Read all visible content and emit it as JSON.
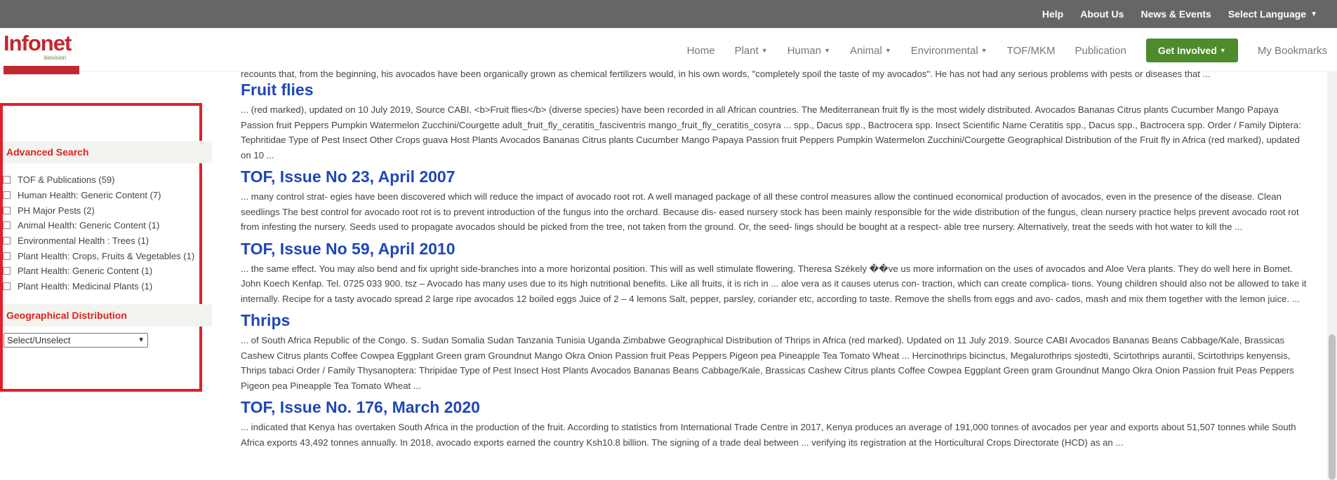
{
  "topbar": {
    "links": [
      "Help",
      "About Us",
      "News & Events"
    ],
    "language": "Select Language"
  },
  "logo": {
    "word": "Infonet",
    "sub": "biovision"
  },
  "nav": {
    "home": "Home",
    "plant": "Plant",
    "human": "Human",
    "animal": "Animal",
    "environmental": "Environmental",
    "tof": "TOF/MKM",
    "publication": "Publication",
    "get_involved": "Get Involved",
    "bookmarks": "My Bookmarks"
  },
  "sidebar": {
    "advanced_search": "Advanced Search",
    "filters": [
      "TOF & Publications (59)",
      "Human Health: Generic Content (7)",
      "PH Major Pests (2)",
      "Animal Health: Generic Content (1)",
      "Environmental Health : Trees (1)",
      "Plant Health: Crops, Fruits & Vegetables (1)",
      "Plant Health: Generic Content (1)",
      "Plant Health: Medicinal Plants (1)"
    ],
    "geo_title": "Geographical Distribution",
    "geo_select": "Select/Unselect"
  },
  "results": {
    "top_snippet": "recounts that, from the beginning, his avocados have been organically grown as chemical fertilizers would, in his own words, \"completely spoil the taste of my avocados\". He has not had any serious problems with pests or diseases that ...",
    "items": [
      {
        "title": "Fruit flies",
        "snippet": "... (red marked), updated on 10 July 2019, Source CABI. <b>Fruit flies</b> (diverse species) have been recorded in all African countries. The Mediterranean fruit fly is the most widely distributed. Avocados Bananas Citrus plants Cucumber Mango Papaya Passion fruit Peppers Pumpkin Watermelon Zucchini/Courgette adult_fruit_fly_ceratitis_fasciventris mango_fruit_fly_ceratitis_cosyra ... spp., Dacus spp., Bactrocera spp. Insect Scientific Name Ceratitis spp., Dacus spp., Bactrocera spp. Order / Family Diptera: Tephritidae Type of Pest Insect Other Crops guava Host Plants Avocados Bananas Citrus plants Cucumber Mango Papaya Passion fruit Peppers Pumpkin Watermelon Zucchini/Courgette Geographical Distribution of the Fruit fly in Africa (red marked), updated on 10 ..."
      },
      {
        "title": "TOF, Issue No 23, April 2007",
        "snippet": "... many control strat- egies have been discovered which will reduce the impact of avocado root rot. A well managed package of all these control measures allow the continued economical production of avocados, even in the presence of the disease. Clean seedlings The best control for avocado root rot is to prevent introduction of the fungus into the orchard. Because dis- eased nursery stock has been mainly responsible for the wide distribution of the fungus, clean nursery practice helps prevent avocado root rot from infesting the nursery. Seeds used to propagate avocados should be picked from the tree, not taken from the ground. Or, the seed- lings should be bought at a respect- able tree nursery. Alternatively, treat the seeds with hot water to kill the ..."
      },
      {
        "title": "TOF, Issue No 59, April 2010",
        "snippet": "... the same effect. You may also bend and fix upright side-branches into a more horizontal position. This will as well stimulate flowering. Theresa Székely ��ve us more information on the uses of avocados and Aloe Vera plants. They do well here in Bomet. John Koech Kenfap. Tel. 0725 033 900. tsz – Avocado has many uses due to its high nutritional benefits. Like all fruits, it is rich in ... aloe vera as it causes uterus con- traction, which can create complica- tions. Young children should also not be allowed to take it internally. Recipe for a tasty avocado spread 2 large ripe avocados 12 boiled eggs Juice of 2 – 4 lemons Salt, pepper, parsley, coriander etc, according to taste. Remove the shells from eggs and avo- cados, mash and mix them together with the lemon juice. ..."
      },
      {
        "title": "Thrips",
        "snippet": "... of South Africa Republic of the Congo. S. Sudan Somalia Sudan Tanzania Tunisia Uganda Zimbabwe Geographical Distribution of Thrips in Africa (red marked). Updated on 11 July 2019. Source CABI Avocados Bananas Beans Cabbage/Kale, Brassicas Cashew Citrus plants Coffee Cowpea Eggplant Green gram Groundnut Mango Okra Onion Passion fruit Peas Peppers Pigeon pea Pineapple Tea Tomato Wheat ... Hercinothrips bicinctus, Megalurothrips sjostedti, Scirtothrips aurantii, Scirtothrips kenyensis, Thrips tabaci Order / Family Thysanoptera: Thripidae Type of Pest Insect Host Plants Avocados Bananas Beans Cabbage/Kale, Brassicas Cashew Citrus plants Coffee Cowpea Eggplant Green gram Groundnut Mango Okra Onion Passion fruit Peas Peppers Pigeon pea Pineapple Tea Tomato Wheat ..."
      },
      {
        "title": "TOF, Issue No. 176, March 2020",
        "snippet": "... indicated that Kenya has overtaken South Africa in the production of the fruit. According to statistics from International Trade Centre in 2017, Kenya produces an average of 191,000 tonnes of avocados per year and exports about 51,507 tonnes while South Africa exports 43,492 tonnes annually. In 2018, avocado exports earned the country Ksh10.8 billion. The signing of a trade deal between ... verifying its registration at the Horticultural Crops Directorate (HCD) as an ..."
      }
    ]
  }
}
